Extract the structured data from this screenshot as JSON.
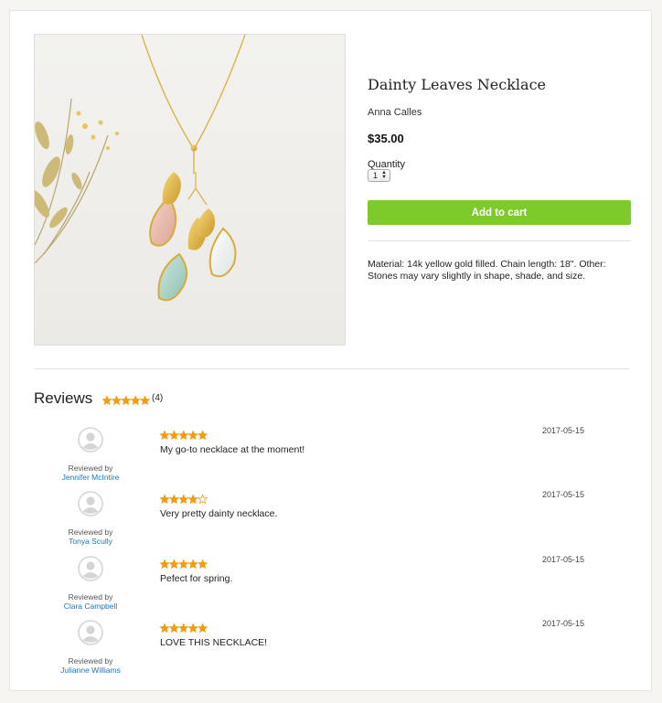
{
  "product": {
    "title": "Dainty Leaves Necklace",
    "vendor": "Anna Calles",
    "price": "$35.00",
    "quantity_label": "Quantity",
    "quantity_value": "1",
    "add_to_cart_label": "Add to cart",
    "description": "Material: 14k yellow gold filled. Chain length: 18\". Other: Stones may vary slightly in shape, shade, and size."
  },
  "reviews_section": {
    "title": "Reviews",
    "average_rating": 5,
    "count_label": "(4)",
    "star_color": "#f39c12"
  },
  "reviews": [
    {
      "rating": 5,
      "text": "My go-to necklace at the moment!",
      "date": "2017-05-15",
      "by_label": "Reviewed by",
      "name": "Jennifer McIntire"
    },
    {
      "rating": 4,
      "text": "Very pretty dainty necklace.",
      "date": "2017-05-15",
      "by_label": "Reviewed by",
      "name": "Tonya Scully"
    },
    {
      "rating": 5,
      "text": "Pefect for spring.",
      "date": "2017-05-15",
      "by_label": "Reviewed by",
      "name": "Clara Campbell"
    },
    {
      "rating": 5,
      "text": "LOVE THIS NECKLACE!",
      "date": "2017-05-15",
      "by_label": "Reviewed by",
      "name": "Julianne Williams"
    }
  ],
  "colors": {
    "accent": "#7dcb2a",
    "link": "#1a77c0"
  }
}
